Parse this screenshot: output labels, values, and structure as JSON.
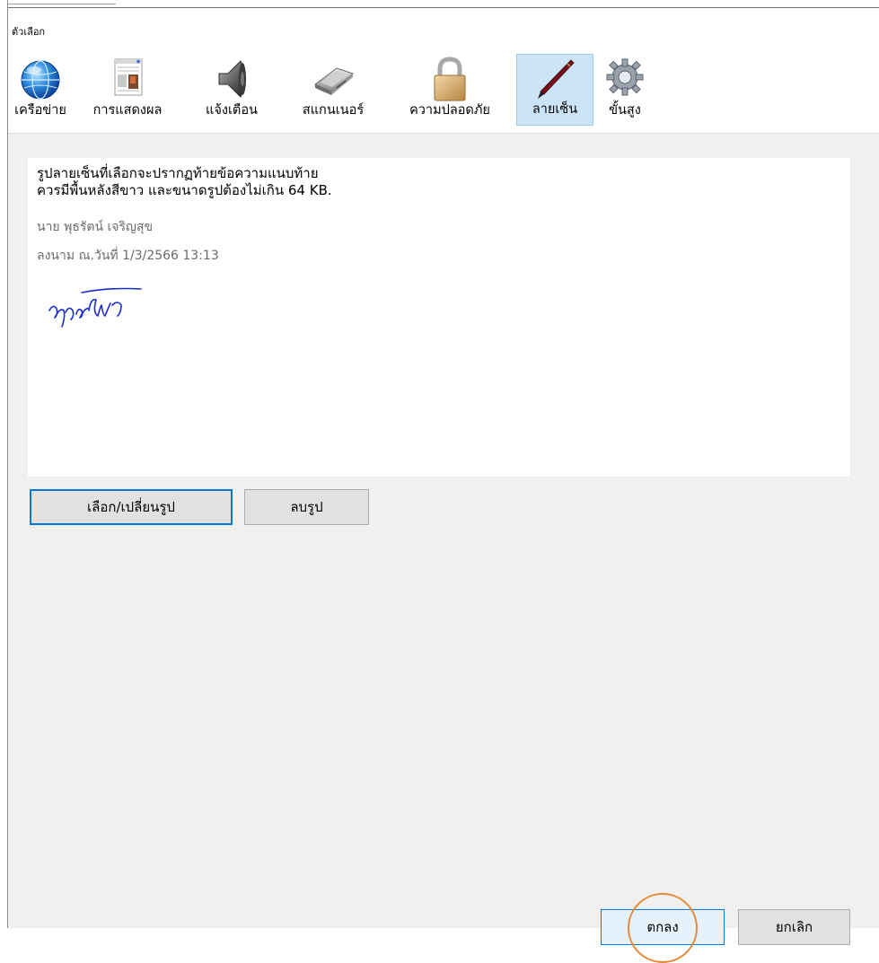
{
  "window": {
    "title": "ตัวเลือก"
  },
  "toolbar": {
    "items": [
      {
        "label": "เครือข่าย",
        "icon": "globe-icon"
      },
      {
        "label": "การแสดงผล",
        "icon": "display-icon"
      },
      {
        "label": "แจ้งเตือน",
        "icon": "speaker-icon"
      },
      {
        "label": "สแกนเนอร์",
        "icon": "scanner-icon"
      },
      {
        "label": "ความปลอดภัย",
        "icon": "lock-icon"
      },
      {
        "label": "ลายเซ็น",
        "icon": "pen-icon",
        "selected": true
      },
      {
        "label": "ขั้นสูง",
        "icon": "gear-icon"
      }
    ]
  },
  "signature": {
    "note_line1": "รูปลายเซ็นที่เลือกจะปรากฏท้ายข้อความแนบท้าย",
    "note_line2": "ควรมีพื้นหลังสีขาว และขนาดรูปต้องไม่เกิน 64 KB.",
    "name": "นาย พุธรัตน์ เจริญสุข",
    "signed_date": "ลงนาม ณ.วันที่ 1/3/2566 13:13",
    "choose_label": "เลือก/เปลี่ยนรูป",
    "remove_label": "ลบรูป"
  },
  "footer": {
    "ok_label": "ตกลง",
    "cancel_label": "ยกเลิก"
  },
  "colors": {
    "accent": "#0078d7",
    "selected_bg": "#cce4f7",
    "highlight_circle": "#e58b3a",
    "signature_ink": "#1a2bd6"
  }
}
